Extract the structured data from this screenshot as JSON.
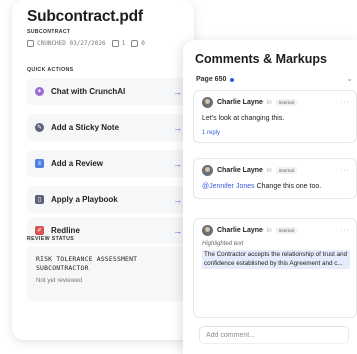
{
  "document": {
    "title": "Subcontract.pdf",
    "type": "SUBCONTRACT",
    "status": "CRUNCHED 03/27/2026",
    "pages_count": "1",
    "comments_count": "0"
  },
  "quick_actions": {
    "label": "QUICK ACTIONS",
    "items": [
      {
        "label": "Chat with CrunchAI",
        "icon": "sparkle-icon",
        "color": "#9b6bd6"
      },
      {
        "label": "Add a Sticky Note",
        "icon": "note-icon",
        "color": "#5b6475"
      },
      {
        "label": "Add a Review",
        "icon": "review-icon",
        "color": "#4f7fe0"
      },
      {
        "label": "Apply a Playbook",
        "icon": "playbook-icon",
        "color": "#5b6475"
      },
      {
        "label": "Redline",
        "icon": "redline-icon",
        "color": "#d9534f"
      }
    ],
    "arrow": "→"
  },
  "review_status": {
    "label": "REVIEW STATUS",
    "title": "RISK TOLERANCE ASSESSMENT SUBCONTRACTOR",
    "status": "Not yet reviewed"
  },
  "comments_panel": {
    "title": "Comments & Markups",
    "page_label": "Page 650",
    "comments": [
      {
        "author": "Charlie Layne",
        "separator": "in",
        "badge": "Internal",
        "text": "Let's look at changing this.",
        "reply": "1 reply"
      },
      {
        "author": "Charlie Layne",
        "separator": "in",
        "badge": "Internal",
        "mention": "@Jennifer Jones",
        "text": " Change this one too."
      },
      {
        "author": "Charlie Layne",
        "separator": "in",
        "badge": "Internal",
        "highlight_label": "Highlighted text",
        "highlight": "The Contractor accepts the relationship of trust and  confidence established by this Agreement and c..."
      }
    ],
    "add_comment_placeholder": "Add comment..."
  },
  "colors": {
    "accent": "#3b5bdb",
    "highlight": "#e6ecfb"
  }
}
